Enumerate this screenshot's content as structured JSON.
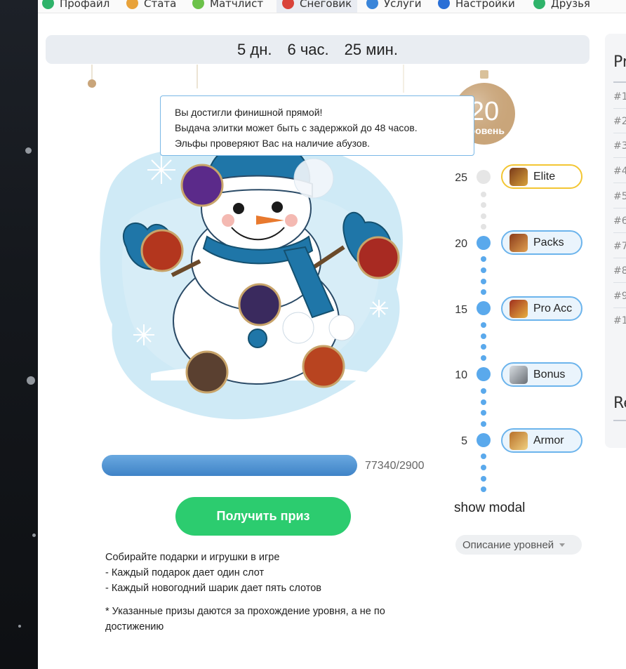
{
  "nav": {
    "tabs": [
      {
        "label": "Профайл",
        "icon": "profile-icon",
        "color": "#2fb36a"
      },
      {
        "label": "Стата",
        "icon": "stats-icon",
        "color": "#e8a23a"
      },
      {
        "label": "Матчлист",
        "icon": "matchlist-icon",
        "color": "#6cc24a"
      },
      {
        "label": "Снеговик",
        "icon": "snowman-icon",
        "color": "#d9433a",
        "active": true
      },
      {
        "label": "Услуги",
        "icon": "services-icon",
        "color": "#3a85d9"
      },
      {
        "label": "Настройки",
        "icon": "settings-icon",
        "color": "#2a6fd6"
      },
      {
        "label": "Друзья",
        "icon": "friends-icon",
        "color": "#2fb36a"
      }
    ]
  },
  "timer": {
    "days": "5 дн.",
    "hours": "6 час.",
    "minutes": "25 мин."
  },
  "tooltip": {
    "line1": "Вы достигли финишной прямой!",
    "line2": "Выдача элитки может быть с задержкой до 48 часов.",
    "line3": "Эльфы проверяют Вас на наличие абузов."
  },
  "level_badge": {
    "number": "20",
    "label": "уровень",
    "color": "#c9a57a"
  },
  "levels": [
    {
      "level": "25",
      "reward": "Elite",
      "icon": "elite-hero-icon",
      "reached": false
    },
    {
      "level": "20",
      "reward": "Packs",
      "icon": "packs-helmet-icon",
      "reached": true
    },
    {
      "level": "15",
      "reward": "Pro Acc",
      "icon": "pro-acc-chest-icon",
      "reached": true
    },
    {
      "level": "10",
      "reward": "Bonus",
      "icon": "bonus-axe-icon",
      "reached": true
    },
    {
      "level": "5",
      "reward": "Armor",
      "icon": "armor-icon",
      "reached": true
    }
  ],
  "progress": {
    "text": "77340/2900",
    "fraction": 1.0,
    "color": "#4a90d2"
  },
  "prize_button": "Получить приз",
  "show_modal": "show modal",
  "levels_dropdown": "Описание уровней",
  "description": {
    "line1": "Собирайте подарки и игрушки в игре",
    "line2": "- Каждый подарок дает один слот",
    "line3": "- Каждый новогодний шарик дает пять слотов"
  },
  "note": "* Указанные призы даются за прохождение уровня, а не по достижению",
  "right_panel": {
    "title": "Pr",
    "title2": "Re",
    "ranks": [
      "#1",
      "#2",
      "#3",
      "#4",
      "#5",
      "#6",
      "#7",
      "#8",
      "#9",
      "#1"
    ]
  },
  "colors": {
    "accent_blue": "#6cb4ec",
    "green": "#2ccc6f",
    "gold": "#f3c633"
  }
}
